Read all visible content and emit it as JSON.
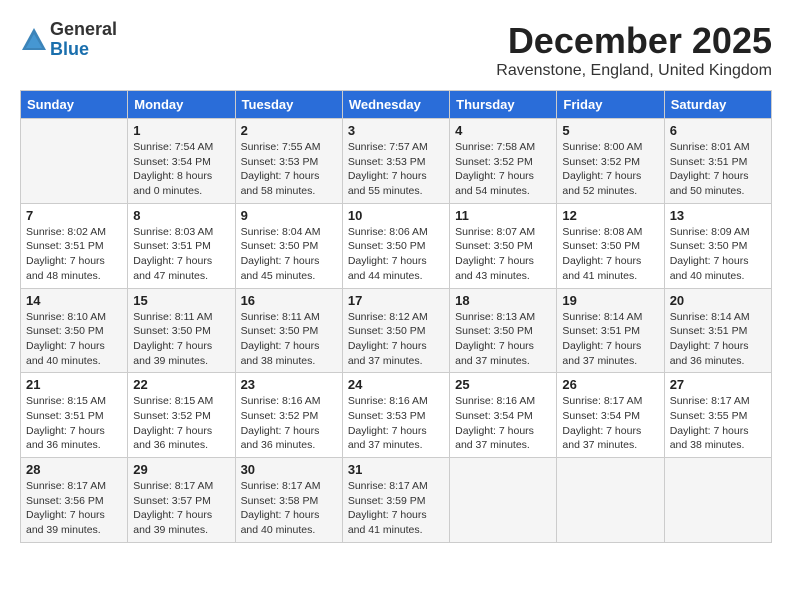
{
  "header": {
    "logo_general": "General",
    "logo_blue": "Blue",
    "month_title": "December 2025",
    "location": "Ravenstone, England, United Kingdom"
  },
  "calendar": {
    "days_of_week": [
      "Sunday",
      "Monday",
      "Tuesday",
      "Wednesday",
      "Thursday",
      "Friday",
      "Saturday"
    ],
    "weeks": [
      [
        {
          "day": "",
          "info": ""
        },
        {
          "day": "1",
          "info": "Sunrise: 7:54 AM\nSunset: 3:54 PM\nDaylight: 8 hours\nand 0 minutes."
        },
        {
          "day": "2",
          "info": "Sunrise: 7:55 AM\nSunset: 3:53 PM\nDaylight: 7 hours\nand 58 minutes."
        },
        {
          "day": "3",
          "info": "Sunrise: 7:57 AM\nSunset: 3:53 PM\nDaylight: 7 hours\nand 55 minutes."
        },
        {
          "day": "4",
          "info": "Sunrise: 7:58 AM\nSunset: 3:52 PM\nDaylight: 7 hours\nand 54 minutes."
        },
        {
          "day": "5",
          "info": "Sunrise: 8:00 AM\nSunset: 3:52 PM\nDaylight: 7 hours\nand 52 minutes."
        },
        {
          "day": "6",
          "info": "Sunrise: 8:01 AM\nSunset: 3:51 PM\nDaylight: 7 hours\nand 50 minutes."
        }
      ],
      [
        {
          "day": "7",
          "info": "Sunrise: 8:02 AM\nSunset: 3:51 PM\nDaylight: 7 hours\nand 48 minutes."
        },
        {
          "day": "8",
          "info": "Sunrise: 8:03 AM\nSunset: 3:51 PM\nDaylight: 7 hours\nand 47 minutes."
        },
        {
          "day": "9",
          "info": "Sunrise: 8:04 AM\nSunset: 3:50 PM\nDaylight: 7 hours\nand 45 minutes."
        },
        {
          "day": "10",
          "info": "Sunrise: 8:06 AM\nSunset: 3:50 PM\nDaylight: 7 hours\nand 44 minutes."
        },
        {
          "day": "11",
          "info": "Sunrise: 8:07 AM\nSunset: 3:50 PM\nDaylight: 7 hours\nand 43 minutes."
        },
        {
          "day": "12",
          "info": "Sunrise: 8:08 AM\nSunset: 3:50 PM\nDaylight: 7 hours\nand 41 minutes."
        },
        {
          "day": "13",
          "info": "Sunrise: 8:09 AM\nSunset: 3:50 PM\nDaylight: 7 hours\nand 40 minutes."
        }
      ],
      [
        {
          "day": "14",
          "info": "Sunrise: 8:10 AM\nSunset: 3:50 PM\nDaylight: 7 hours\nand 40 minutes."
        },
        {
          "day": "15",
          "info": "Sunrise: 8:11 AM\nSunset: 3:50 PM\nDaylight: 7 hours\nand 39 minutes."
        },
        {
          "day": "16",
          "info": "Sunrise: 8:11 AM\nSunset: 3:50 PM\nDaylight: 7 hours\nand 38 minutes."
        },
        {
          "day": "17",
          "info": "Sunrise: 8:12 AM\nSunset: 3:50 PM\nDaylight: 7 hours\nand 37 minutes."
        },
        {
          "day": "18",
          "info": "Sunrise: 8:13 AM\nSunset: 3:50 PM\nDaylight: 7 hours\nand 37 minutes."
        },
        {
          "day": "19",
          "info": "Sunrise: 8:14 AM\nSunset: 3:51 PM\nDaylight: 7 hours\nand 37 minutes."
        },
        {
          "day": "20",
          "info": "Sunrise: 8:14 AM\nSunset: 3:51 PM\nDaylight: 7 hours\nand 36 minutes."
        }
      ],
      [
        {
          "day": "21",
          "info": "Sunrise: 8:15 AM\nSunset: 3:51 PM\nDaylight: 7 hours\nand 36 minutes."
        },
        {
          "day": "22",
          "info": "Sunrise: 8:15 AM\nSunset: 3:52 PM\nDaylight: 7 hours\nand 36 minutes."
        },
        {
          "day": "23",
          "info": "Sunrise: 8:16 AM\nSunset: 3:52 PM\nDaylight: 7 hours\nand 36 minutes."
        },
        {
          "day": "24",
          "info": "Sunrise: 8:16 AM\nSunset: 3:53 PM\nDaylight: 7 hours\nand 37 minutes."
        },
        {
          "day": "25",
          "info": "Sunrise: 8:16 AM\nSunset: 3:54 PM\nDaylight: 7 hours\nand 37 minutes."
        },
        {
          "day": "26",
          "info": "Sunrise: 8:17 AM\nSunset: 3:54 PM\nDaylight: 7 hours\nand 37 minutes."
        },
        {
          "day": "27",
          "info": "Sunrise: 8:17 AM\nSunset: 3:55 PM\nDaylight: 7 hours\nand 38 minutes."
        }
      ],
      [
        {
          "day": "28",
          "info": "Sunrise: 8:17 AM\nSunset: 3:56 PM\nDaylight: 7 hours\nand 39 minutes."
        },
        {
          "day": "29",
          "info": "Sunrise: 8:17 AM\nSunset: 3:57 PM\nDaylight: 7 hours\nand 39 minutes."
        },
        {
          "day": "30",
          "info": "Sunrise: 8:17 AM\nSunset: 3:58 PM\nDaylight: 7 hours\nand 40 minutes."
        },
        {
          "day": "31",
          "info": "Sunrise: 8:17 AM\nSunset: 3:59 PM\nDaylight: 7 hours\nand 41 minutes."
        },
        {
          "day": "",
          "info": ""
        },
        {
          "day": "",
          "info": ""
        },
        {
          "day": "",
          "info": ""
        }
      ]
    ]
  }
}
